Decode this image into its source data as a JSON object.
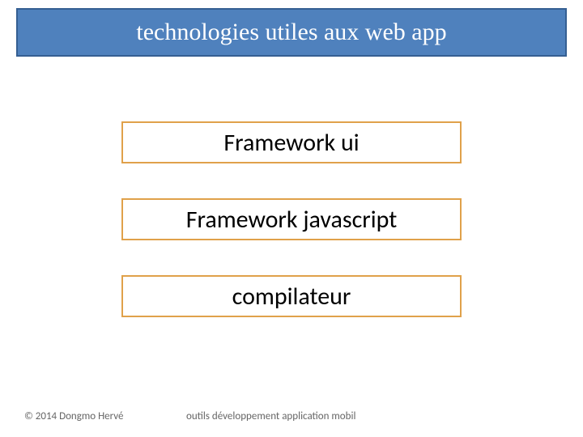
{
  "title": "technologies utiles aux web app",
  "items": [
    {
      "label": "Framework ui"
    },
    {
      "label": "Framework javascript"
    },
    {
      "label": "compilateur"
    }
  ],
  "footer": {
    "copyright": "© 2014 Dongmo Hervé",
    "center": "outils développement application mobil"
  }
}
